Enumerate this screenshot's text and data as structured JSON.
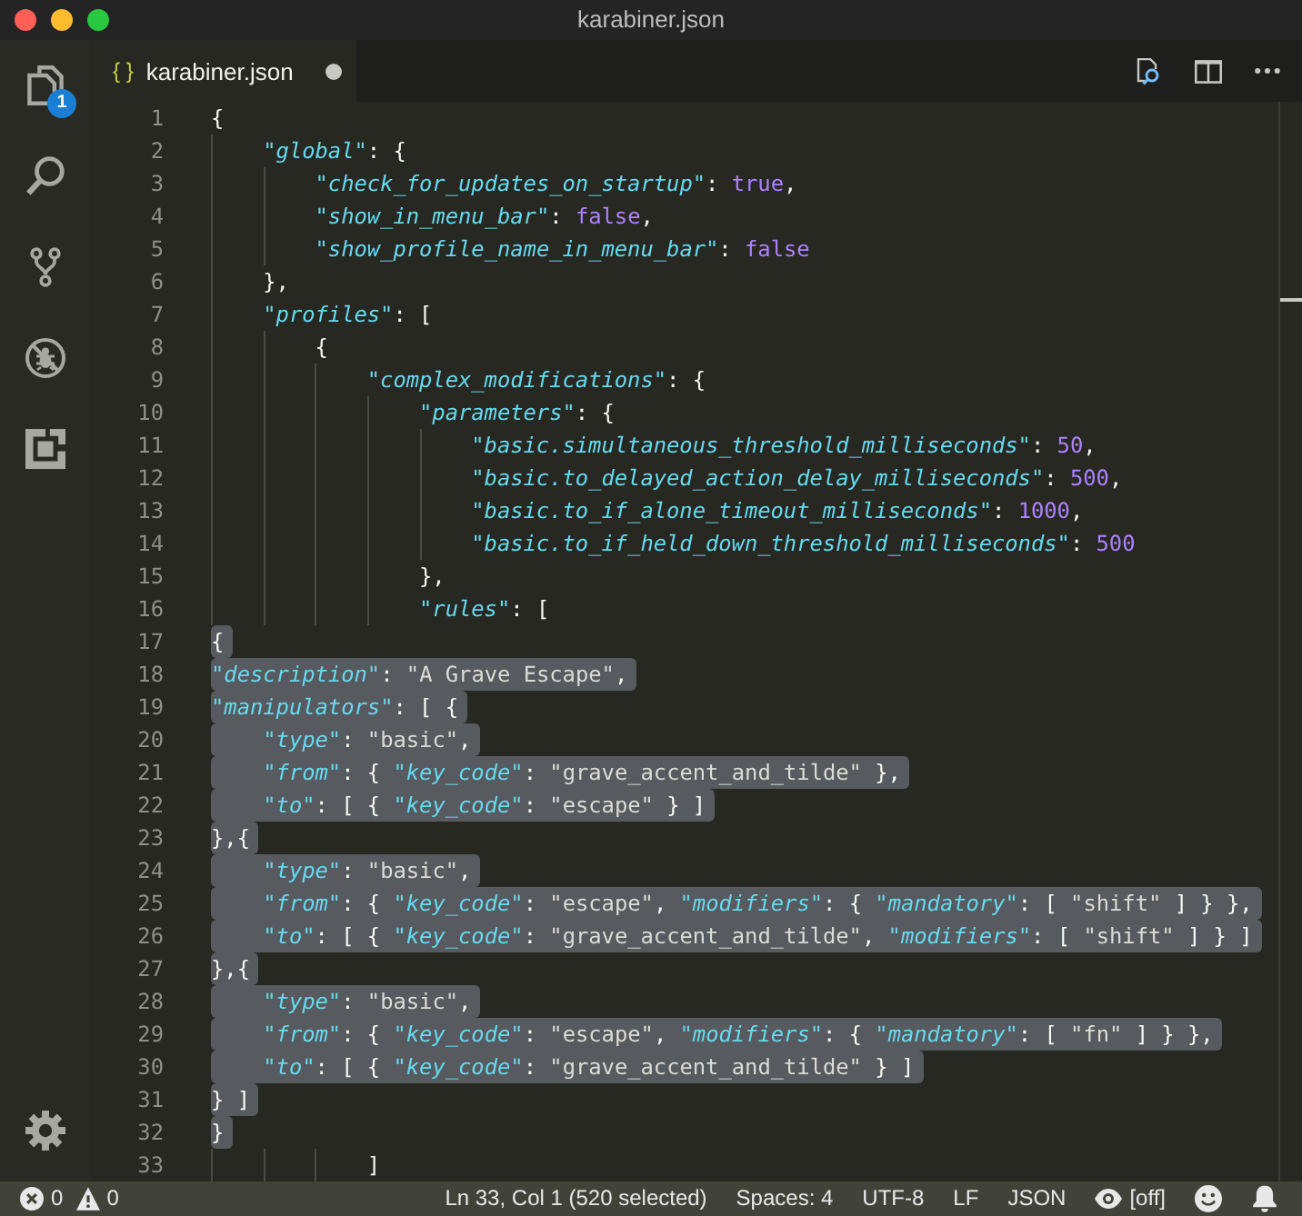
{
  "window": {
    "title": "karabiner.json"
  },
  "activity_bar": {
    "items": [
      {
        "kind": "files",
        "badge": "1"
      },
      {
        "kind": "search"
      },
      {
        "kind": "source_control"
      },
      {
        "kind": "debug"
      },
      {
        "kind": "extensions"
      }
    ],
    "bottom_items": [
      {
        "kind": "settings"
      }
    ]
  },
  "tabs": [
    {
      "icon": "{ }",
      "label": "karabiner.json",
      "modified": true,
      "selected": true
    }
  ],
  "editor_actions": [
    {
      "kind": "open_changes"
    },
    {
      "kind": "split"
    },
    {
      "kind": "more"
    }
  ],
  "editor": {
    "lines": [
      {
        "number": "1",
        "text": "{",
        "selected": false
      },
      {
        "number": "2",
        "text": "    \"global\": {",
        "selected": false
      },
      {
        "number": "3",
        "text": "        \"check_for_updates_on_startup\": true,",
        "selected": false
      },
      {
        "number": "4",
        "text": "        \"show_in_menu_bar\": false,",
        "selected": false
      },
      {
        "number": "5",
        "text": "        \"show_profile_name_in_menu_bar\": false",
        "selected": false
      },
      {
        "number": "6",
        "text": "    },",
        "selected": false
      },
      {
        "number": "7",
        "text": "    \"profiles\": [",
        "selected": false
      },
      {
        "number": "8",
        "text": "        {",
        "selected": false
      },
      {
        "number": "9",
        "text": "            \"complex_modifications\": {",
        "selected": false
      },
      {
        "number": "10",
        "text": "                \"parameters\": {",
        "selected": false
      },
      {
        "number": "11",
        "text": "                    \"basic.simultaneous_threshold_milliseconds\": 50,",
        "selected": false
      },
      {
        "number": "12",
        "text": "                    \"basic.to_delayed_action_delay_milliseconds\": 500,",
        "selected": false
      },
      {
        "number": "13",
        "text": "                    \"basic.to_if_alone_timeout_milliseconds\": 1000,",
        "selected": false
      },
      {
        "number": "14",
        "text": "                    \"basic.to_if_held_down_threshold_milliseconds\": 500",
        "selected": false
      },
      {
        "number": "15",
        "text": "                },",
        "selected": false
      },
      {
        "number": "16",
        "text": "                \"rules\": [",
        "selected": false
      },
      {
        "number": "17",
        "text": "{",
        "selected": true
      },
      {
        "number": "18",
        "text": "\"description\": \"A Grave Escape\",",
        "selected": true
      },
      {
        "number": "19",
        "text": "\"manipulators\": [ {",
        "selected": true
      },
      {
        "number": "20",
        "text": "    \"type\": \"basic\",",
        "selected": true
      },
      {
        "number": "21",
        "text": "    \"from\": { \"key_code\": \"grave_accent_and_tilde\" },",
        "selected": true
      },
      {
        "number": "22",
        "text": "    \"to\": [ { \"key_code\": \"escape\" } ]",
        "selected": true
      },
      {
        "number": "23",
        "text": "},{",
        "selected": true
      },
      {
        "number": "24",
        "text": "    \"type\": \"basic\",",
        "selected": true
      },
      {
        "number": "25",
        "text": "    \"from\": { \"key_code\": \"escape\", \"modifiers\": { \"mandatory\": [ \"shift\" ] } },",
        "selected": true
      },
      {
        "number": "26",
        "text": "    \"to\": [ { \"key_code\": \"grave_accent_and_tilde\", \"modifiers\": [ \"shift\" ] } ]",
        "selected": true
      },
      {
        "number": "27",
        "text": "},{",
        "selected": true
      },
      {
        "number": "28",
        "text": "    \"type\": \"basic\",",
        "selected": true
      },
      {
        "number": "29",
        "text": "    \"from\": { \"key_code\": \"escape\", \"modifiers\": { \"mandatory\": [ \"fn\" ] } },",
        "selected": true
      },
      {
        "number": "30",
        "text": "    \"to\": [ { \"key_code\": \"grave_accent_and_tilde\" } ]",
        "selected": true
      },
      {
        "number": "31",
        "text": "} ]",
        "selected": true
      },
      {
        "number": "32",
        "text": "}",
        "selected": true
      },
      {
        "number": "33",
        "text": "            ]",
        "selected": false
      }
    ]
  },
  "status_bar": {
    "left": [
      {
        "kind": "errors",
        "label": "0"
      },
      {
        "kind": "warnings",
        "label": "0"
      }
    ],
    "right": [
      {
        "kind": "text",
        "label": "Ln 33, Col 1 (520 selected)"
      },
      {
        "kind": "text",
        "label": "Spaces: 4"
      },
      {
        "kind": "text",
        "label": "UTF-8"
      },
      {
        "kind": "text",
        "label": "LF"
      },
      {
        "kind": "text",
        "label": "JSON"
      },
      {
        "kind": "eye",
        "label": "[off]"
      },
      {
        "kind": "feedback"
      },
      {
        "kind": "notifications"
      }
    ]
  }
}
